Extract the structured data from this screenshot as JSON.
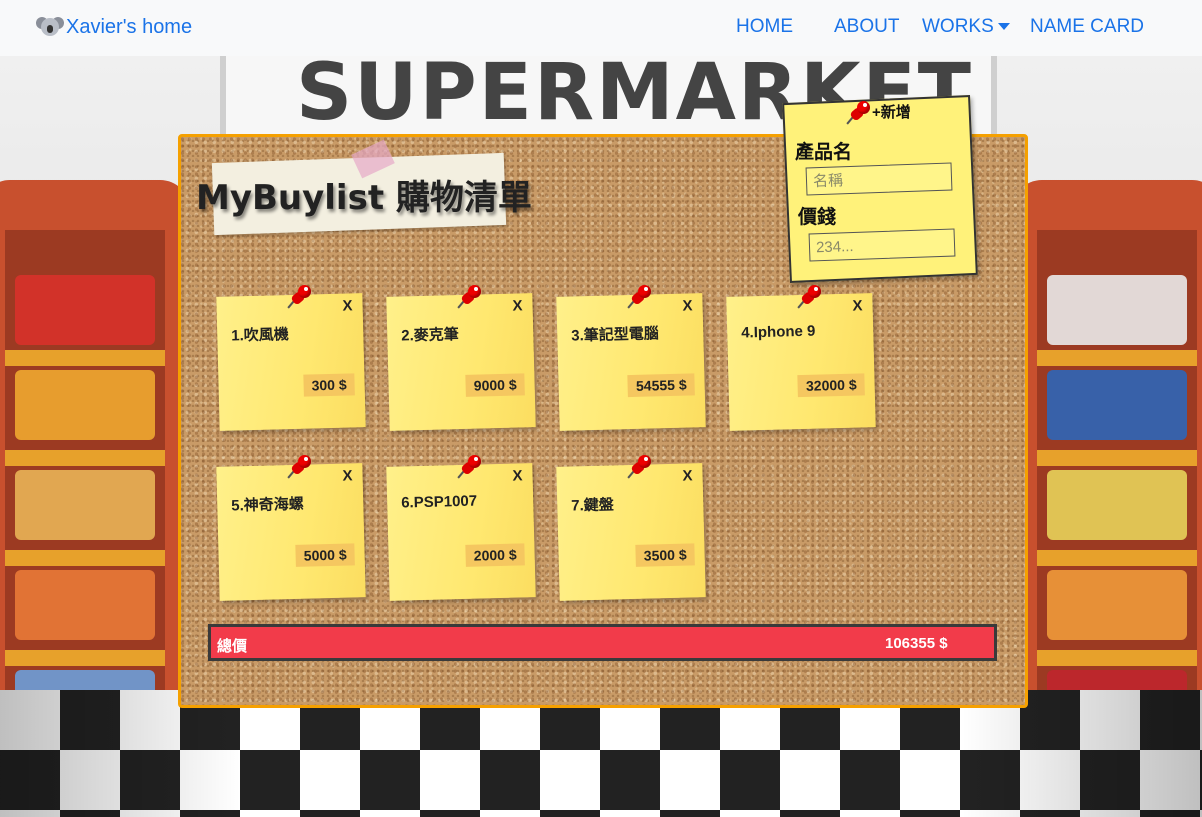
{
  "nav": {
    "brand": "Xavier's home",
    "links": [
      "HOME",
      "ABOUT",
      "WORKS",
      "NAME CARD"
    ]
  },
  "background": {
    "sign_text": "SUPERMARKET"
  },
  "board": {
    "title": "MyBuylist 購物清單"
  },
  "form": {
    "add_label": "+新增",
    "name_label": "產品名",
    "name_placeholder": "名稱",
    "price_label": "價錢",
    "price_placeholder": "234..."
  },
  "items": [
    {
      "name": "1.吹風機",
      "price": "300 $",
      "delete": "X"
    },
    {
      "name": "2.麥克筆",
      "price": "9000 $",
      "delete": "X"
    },
    {
      "name": "3.筆記型電腦",
      "price": "54555 $",
      "delete": "X"
    },
    {
      "name": "4.Iphone 9",
      "price": "32000 $",
      "delete": "X"
    },
    {
      "name": "5.神奇海螺",
      "price": "5000 $",
      "delete": "X"
    },
    {
      "name": "6.PSP1007",
      "price": "2000 $",
      "delete": "X"
    },
    {
      "name": "7.鍵盤",
      "price": "3500 $",
      "delete": "X"
    }
  ],
  "total": {
    "label": "總價",
    "value": "106355 $"
  },
  "colors": {
    "nav_link": "#1a73e8",
    "board_border": "#f5a000",
    "note": "#fff08a",
    "total_bar": "#f23b4a"
  }
}
